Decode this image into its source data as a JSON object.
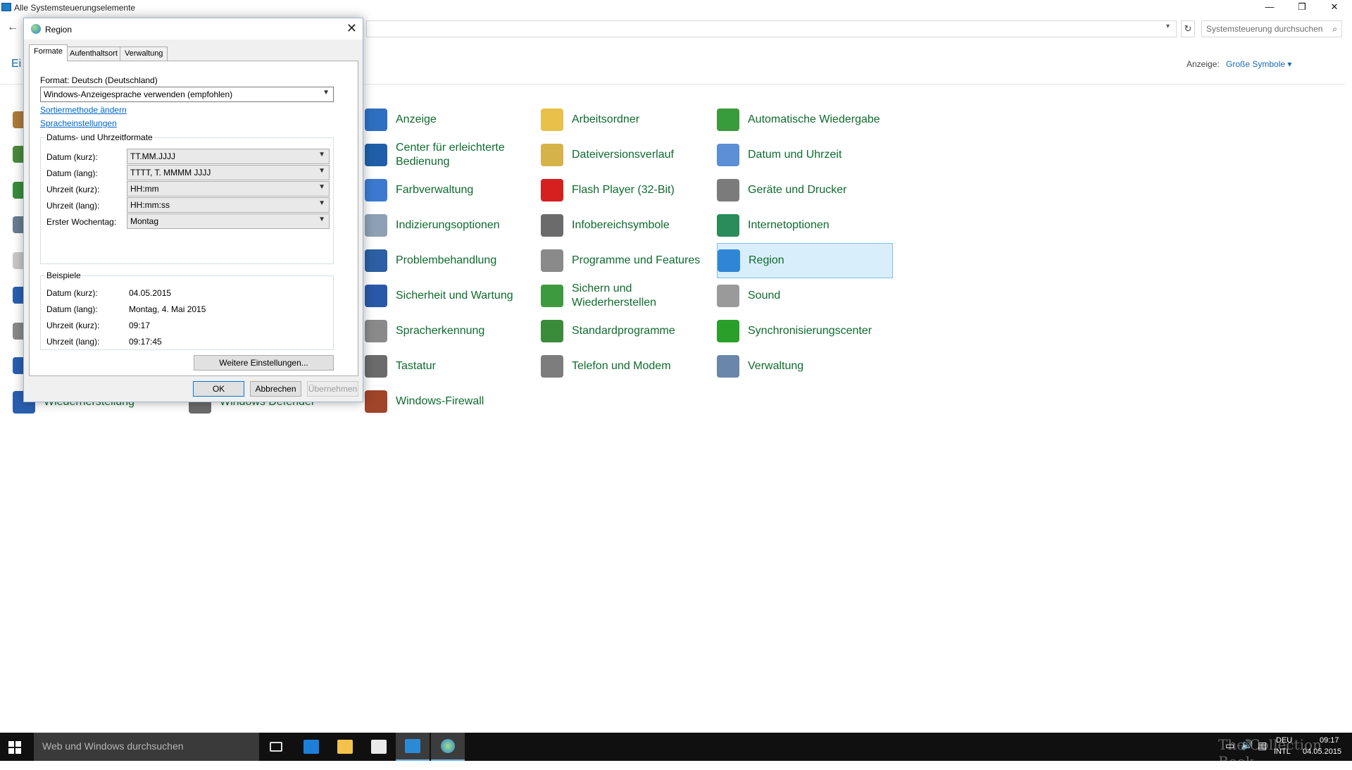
{
  "window": {
    "title": "Alle Systemsteuerungselemente",
    "minimize": "—",
    "maximize": "❐",
    "close": "✕"
  },
  "address": {
    "back": "←",
    "dropdown": "▾",
    "refresh": "↻",
    "search_placeholder": "Systemsteuerung durchsuchen",
    "search_icon": "⌕"
  },
  "view": {
    "left_text": "Ei",
    "label": "Anzeige:",
    "value": "Große Symbole ▾"
  },
  "items": [
    {
      "label": "Anzeige",
      "icon": "monitor-icon",
      "color": "#2e6fc2"
    },
    {
      "label": "Arbeitsordner",
      "icon": "folder-icon",
      "color": "#e8c04a"
    },
    {
      "label": "Automatische Wiedergabe",
      "icon": "autoplay-icon",
      "color": "#3a9b3a"
    },
    {
      "label": "Center für erleichterte Bedienung",
      "icon": "ease-of-access-icon",
      "color": "#1f5fa8"
    },
    {
      "label": "Dateiversionsverlauf",
      "icon": "file-history-icon",
      "color": "#d6b24a"
    },
    {
      "label": "Datum und Uhrzeit",
      "icon": "clock-icon",
      "color": "#5b8fd6"
    },
    {
      "label": "Farbverwaltung",
      "icon": "color-management-icon",
      "color": "#3b7ad0"
    },
    {
      "label": "Flash Player (32-Bit)",
      "icon": "flash-icon",
      "color": "#d62020"
    },
    {
      "label": "Geräte und Drucker",
      "icon": "printer-icon",
      "color": "#7b7b7b"
    },
    {
      "label": "Indizierungsoptionen",
      "icon": "indexing-icon",
      "color": "#8da0b4"
    },
    {
      "label": "Infobereichsymbole",
      "icon": "notification-icon",
      "color": "#6b6b6b"
    },
    {
      "label": "Internetoptionen",
      "icon": "internet-options-icon",
      "color": "#2a8c5a"
    },
    {
      "label": "Problembehandlung",
      "icon": "troubleshoot-icon",
      "color": "#2c5fa3"
    },
    {
      "label": "Programme und Features",
      "icon": "programs-icon",
      "color": "#8a8a8a"
    },
    {
      "label": "Region",
      "icon": "globe-icon",
      "color": "#2f86d6"
    },
    {
      "label": "Sicherheit und Wartung",
      "icon": "flag-icon",
      "color": "#2a58a8"
    },
    {
      "label": "Sichern und Wiederherstellen",
      "icon": "backup-icon",
      "color": "#3e9a3e"
    },
    {
      "label": "Sound",
      "icon": "speaker-icon",
      "color": "#9a9a9a"
    },
    {
      "label": "Spracherkennung",
      "icon": "microphone-icon",
      "color": "#8a8a8a"
    },
    {
      "label": "Standardprogramme",
      "icon": "default-programs-icon",
      "color": "#3a8c3a"
    },
    {
      "label": "Synchronisierungscenter",
      "icon": "sync-icon",
      "color": "#2aa02a"
    },
    {
      "label": "Tastatur",
      "icon": "keyboard-icon",
      "color": "#6b6b6b"
    },
    {
      "label": "Telefon und Modem",
      "icon": "phone-icon",
      "color": "#7d7d7d"
    },
    {
      "label": "Verwaltung",
      "icon": "admin-tools-icon",
      "color": "#6a86a8"
    },
    {
      "label": "Windows-Firewall",
      "icon": "firewall-icon",
      "color": "#a0442a"
    }
  ],
  "partial_items": [
    "Wiederherstellung",
    "Windows Defender"
  ],
  "dialog": {
    "title": "Region",
    "close": "✕",
    "tabs": [
      "Formate",
      "Aufenthaltsort",
      "Verwaltung"
    ],
    "format_label": "Format: Deutsch (Deutschland)",
    "format_value": "Windows-Anzeigesprache verwenden (empfohlen)",
    "link_sort": "Sortiermethode ändern",
    "link_lang": "Spracheinstellungen",
    "group_formats": "Datums- und Uhrzeitformate",
    "rows": [
      {
        "label": "Datum (kurz):",
        "value": "TT.MM.JJJJ"
      },
      {
        "label": "Datum (lang):",
        "value": "TTTT, T. MMMM JJJJ"
      },
      {
        "label": "Uhrzeit (kurz):",
        "value": "HH:mm"
      },
      {
        "label": "Uhrzeit (lang):",
        "value": "HH:mm:ss"
      },
      {
        "label": "Erster Wochentag:",
        "value": "Montag"
      }
    ],
    "group_examples": "Beispiele",
    "examples": [
      {
        "label": "Datum (kurz):",
        "value": "04.05.2015"
      },
      {
        "label": "Datum (lang):",
        "value": "Montag, 4. Mai 2015"
      },
      {
        "label": "Uhrzeit (kurz):",
        "value": "09:17"
      },
      {
        "label": "Uhrzeit (lang):",
        "value": "09:17:45"
      }
    ],
    "more_button": "Weitere Einstellungen...",
    "ok": "OK",
    "cancel": "Abbrechen",
    "apply": "Übernehmen"
  },
  "taskbar": {
    "search": "Web und Windows durchsuchen",
    "lang": "DEU",
    "layout": "INTL",
    "time": "09:17",
    "date": "04.05.2015",
    "watermark": "The Collection Book"
  }
}
